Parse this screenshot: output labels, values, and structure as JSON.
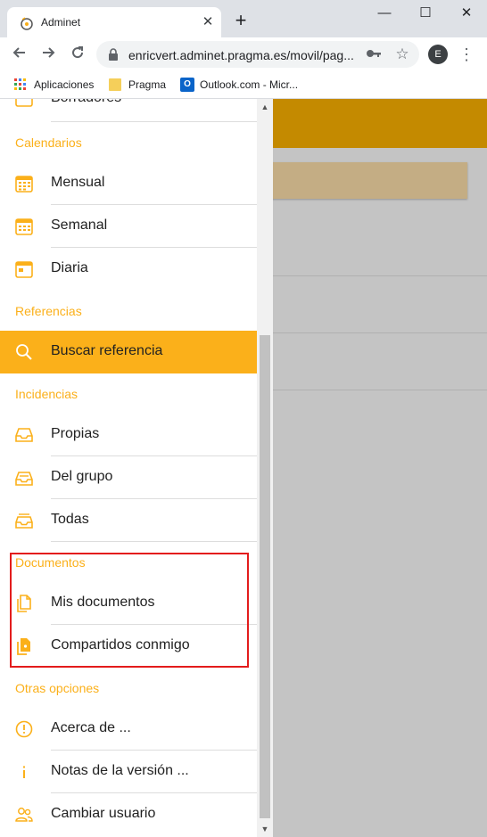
{
  "browser": {
    "tab_title": "Adminet",
    "tab_close": "✕",
    "new_tab": "+",
    "window_controls": {
      "minimize": "—",
      "maximize": "☐",
      "close": "✕"
    },
    "url": "enricvert.adminet.pragma.es/movil/pag...",
    "profile_initial": "E",
    "bookmarks": [
      {
        "label": "Aplicaciones",
        "icon": "apps-grid-icon"
      },
      {
        "label": "Pragma",
        "icon": "folder-icon"
      },
      {
        "label": "Outlook.com - Micr...",
        "icon": "outlook-icon"
      }
    ]
  },
  "drawer": {
    "partial_item": "Borradores",
    "sections": {
      "calendarios": "Calendarios",
      "referencias": "Referencias",
      "incidencias": "Incidencias",
      "documentos": "Documentos",
      "otras": "Otras opciones"
    },
    "items": {
      "mensual": "Mensual",
      "semanal": "Semanal",
      "diaria": "Diaria",
      "buscar": "Buscar referencia",
      "propias": "Propias",
      "del_grupo": "Del grupo",
      "todas": "Todas",
      "mis_documentos": "Mis documentos",
      "compartidos": "Compartidos conmigo",
      "acerca": "Acerca de ...",
      "notas": "Notas de la versión ...",
      "cambiar_usuario": "Cambiar usuario"
    },
    "active_item": "Buscar referencia"
  },
  "colors": {
    "accent": "#fbb01a",
    "header_bg": "#c48a00",
    "overlay": "#c4c4c4",
    "highlight_border": "#e31c1c"
  }
}
